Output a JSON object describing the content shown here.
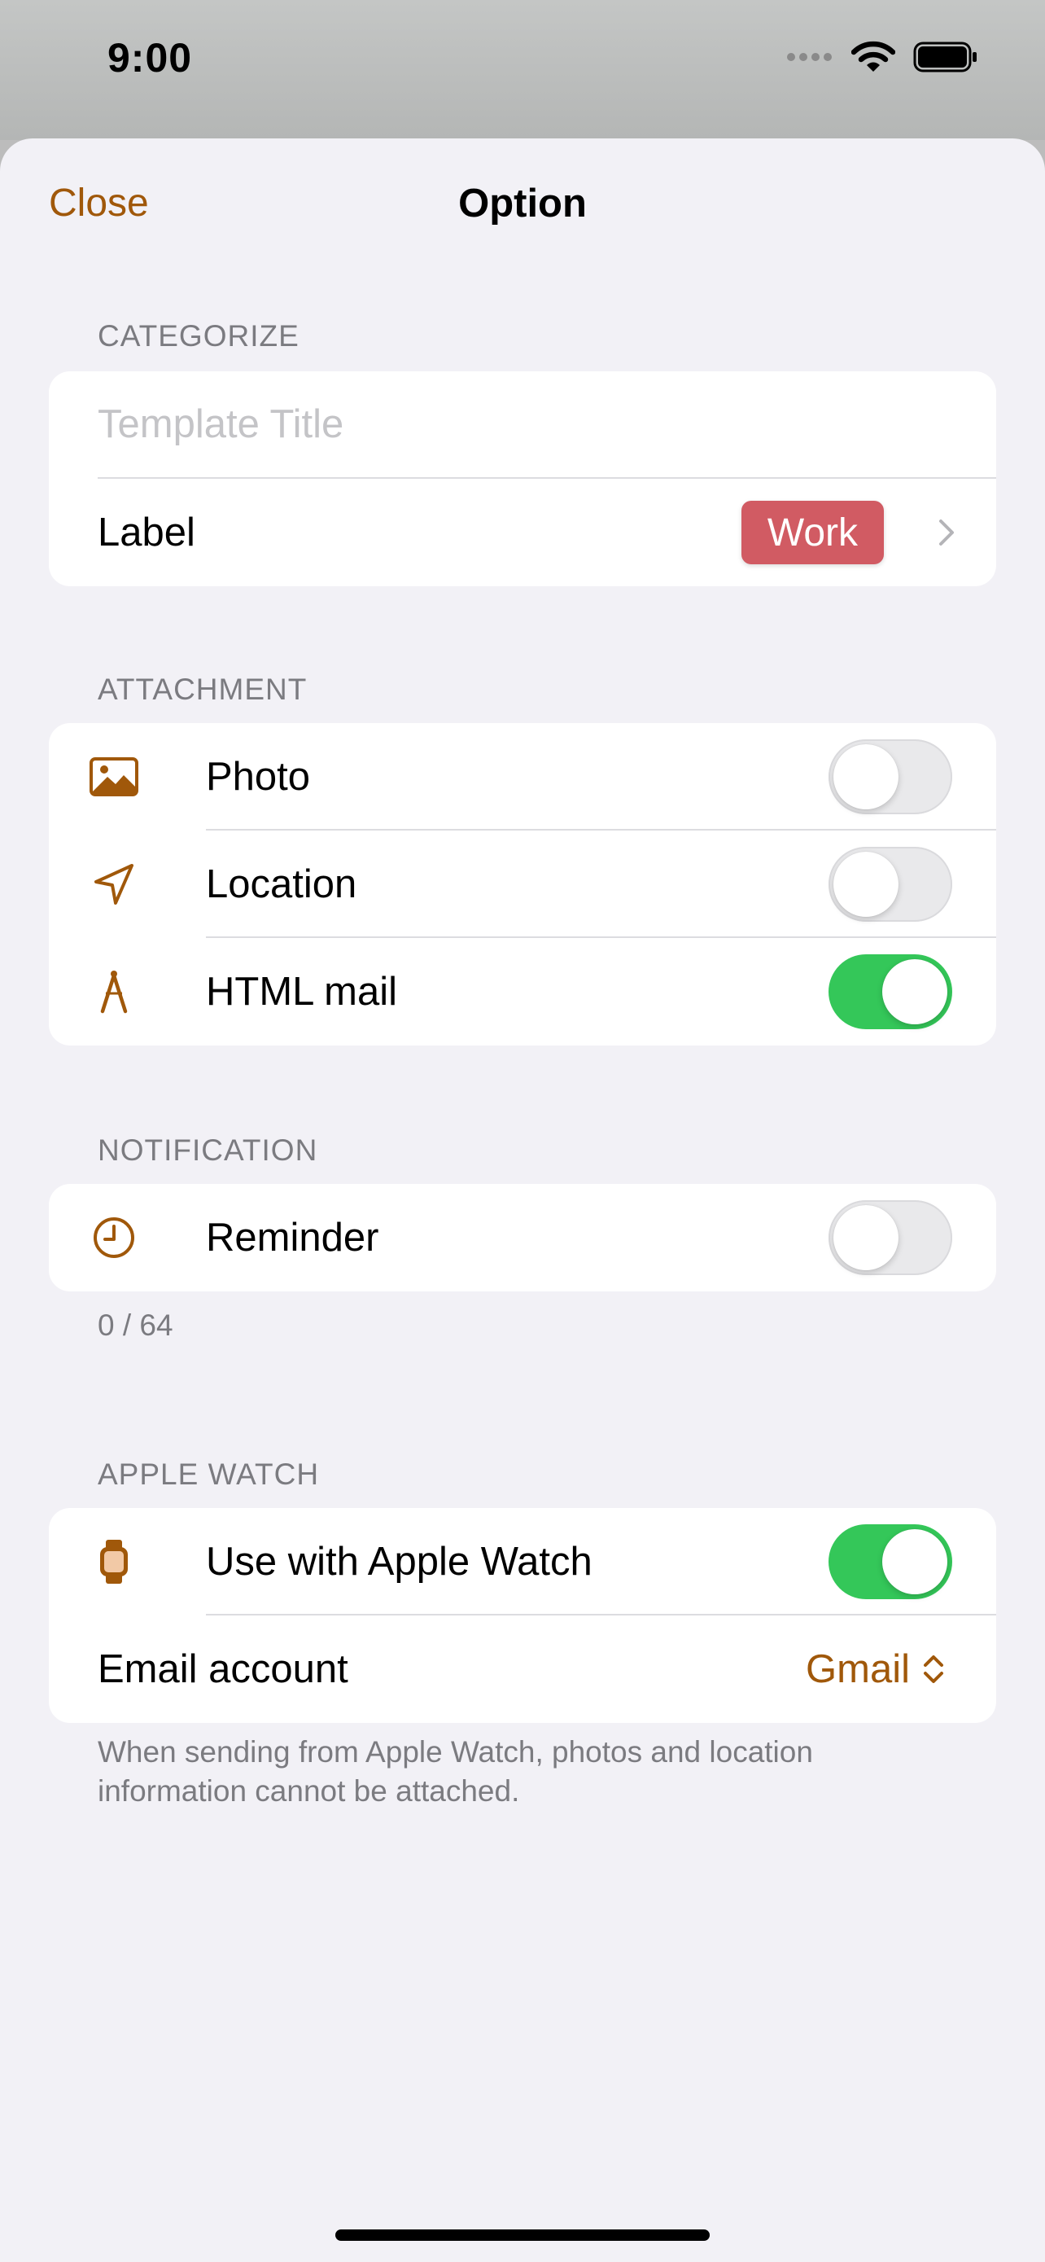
{
  "status_bar": {
    "time": "9:00"
  },
  "nav": {
    "close_label": "Close",
    "title": "Option"
  },
  "categorize": {
    "header": "CATEGORIZE",
    "title_placeholder": "Template Title",
    "title_value": "",
    "label_text": "Label",
    "label_badge": "Work",
    "badge_color": "#d15b63"
  },
  "attachment": {
    "header": "ATTACHMENT",
    "photo": {
      "label": "Photo",
      "on": false
    },
    "location": {
      "label": "Location",
      "on": false
    },
    "html_mail": {
      "label": "HTML mail",
      "on": true
    }
  },
  "notification": {
    "header": "NOTIFICATION",
    "reminder": {
      "label": "Reminder",
      "on": false
    },
    "count": "0 / 64"
  },
  "apple_watch": {
    "header": "APPLE WATCH",
    "use_watch": {
      "label": "Use with Apple Watch",
      "on": true
    },
    "email_account_label": "Email account",
    "email_account_value": "Gmail",
    "note": "When sending from Apple Watch, photos and location information cannot be attached."
  },
  "colors": {
    "accent": "#a0580a",
    "toggle_on": "#34c759",
    "background": "#f2f1f6"
  }
}
